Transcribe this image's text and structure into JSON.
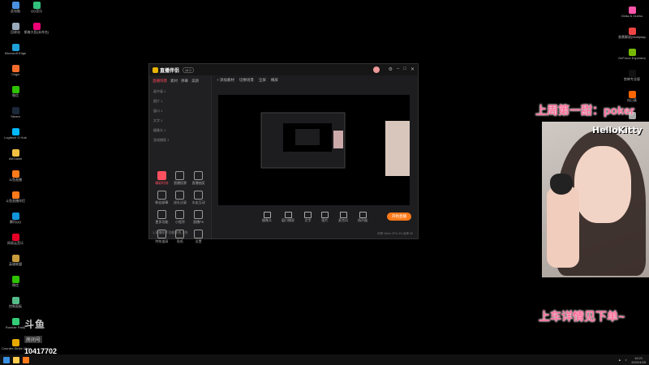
{
  "desktop": {
    "left_icons": [
      {
        "label": "此电脑",
        "color": "#4a90e2"
      },
      {
        "label": "回收站",
        "color": "#9ab"
      },
      {
        "label": "Microsoft Edge",
        "color": "#1fa0d8"
      },
      {
        "label": "Origin",
        "color": "#f56c2d"
      },
      {
        "label": "微信",
        "color": "#2dc100"
      },
      {
        "label": "Steam",
        "color": "#1b2838"
      },
      {
        "label": "Logitech G Hub",
        "color": "#00b8fc"
      },
      {
        "label": "WeGame",
        "color": "#f0c040"
      },
      {
        "label": "斗鱼直播",
        "color": "#ff7a1a"
      },
      {
        "label": "斗鱼直播伴侣",
        "color": "#ff7a1a"
      },
      {
        "label": "腾讯QQ",
        "color": "#1296db"
      },
      {
        "label": "网易云音乐",
        "color": "#e60026"
      },
      {
        "label": "英雄联盟",
        "color": "#c89b3c"
      },
      {
        "label": "微信",
        "color": "#2dc100"
      },
      {
        "label": "控制面板",
        "color": "#5b8"
      },
      {
        "label": "Rumble Party",
        "color": "#3c7"
      },
      {
        "label": "Counter-Strike Global Offensive",
        "color": "#e6a800"
      }
    ],
    "left2_icons": [
      {
        "label": "QQ音乐",
        "color": "#31c27c"
      },
      {
        "label": "斯森大阳(未命名)",
        "color": "#e07"
      }
    ],
    "right_icons": [
      {
        "label": "Draw & Guess",
        "color": "#f5a"
      },
      {
        "label": "香蕉解说(Multiplayer)",
        "color": "#e44"
      },
      {
        "label": "GeForce Experience",
        "color": "#76b900"
      },
      {
        "label": "剪映专业版",
        "color": "#111"
      },
      {
        "label": "向日葵",
        "color": "#f60"
      },
      {
        "label": "",
        "color": "#aaa"
      },
      {
        "label": "CV字幕",
        "color": "#39f"
      },
      {
        "label": "说明文档",
        "color": "#ddd"
      },
      {
        "label": "Apex Legends",
        "color": "#c33"
      }
    ]
  },
  "app": {
    "name": "直播伴侣",
    "version": "v6.0",
    "sidebar_tabs": [
      "直播场景",
      "素材",
      "弹幕",
      "美颜"
    ],
    "sources": [
      "画中画 1",
      "图片 1",
      "窗口 1",
      "文字 1",
      "摄像头 1",
      "游戏捕获 1"
    ],
    "grid": [
      {
        "label": "精彩时刻",
        "hl": true
      },
      {
        "label": "直播投票",
        "hl": false
      },
      {
        "label": "直播抽奖",
        "hl": false
      },
      {
        "label": "粉丝勋章",
        "hl": false
      },
      {
        "label": "送礼记录",
        "hl": false
      },
      {
        "label": "水友互动",
        "hl": false
      },
      {
        "label": "更多功能",
        "hl": false
      },
      {
        "label": "小程序",
        "hl": false
      },
      {
        "label": "直播PK",
        "hl": false
      },
      {
        "label": "特效道具",
        "hl": false
      },
      {
        "label": "贴纸",
        "hl": false
      },
      {
        "label": "设置",
        "hl": false
      }
    ],
    "footer": "1.直播助手功能即将上线",
    "toolbar": [
      "+ 添加素材",
      "切换场景",
      "全屏",
      "横屏"
    ],
    "bottom_buttons": [
      "摄像头",
      "窗口捕获",
      "文字",
      "图片",
      "麦克风",
      "扬声器"
    ],
    "start_label": "开始直播",
    "status": "码率 0kb/s  CPU 4%  帧率 60"
  },
  "overlay": {
    "top_text": "上周第一甜：poker",
    "bottom_text": "上车详情见下单~",
    "hello_text": "HelloKitty",
    "room_logo": "斗鱼",
    "room_badge": "房间号",
    "room_number": "10417702"
  },
  "taskbar": {
    "clock_time": "16:21",
    "clock_date": "2022/4/25"
  }
}
